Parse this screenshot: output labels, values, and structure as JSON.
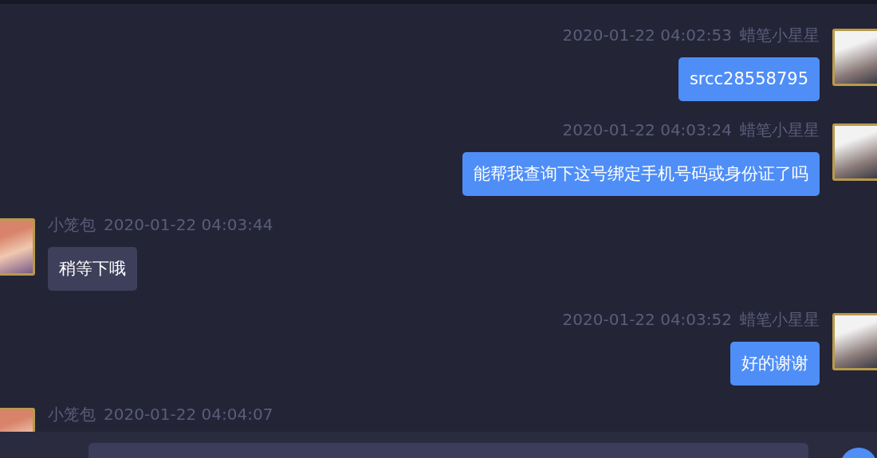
{
  "messages": [
    {
      "kind": "right",
      "time": "2020-01-22 04:02:53",
      "sender": "蜡笔小星星",
      "text": "srcc28558795"
    },
    {
      "kind": "right",
      "time": "2020-01-22 04:03:24",
      "sender": "蜡笔小星星",
      "text": "能帮我查询下这号绑定手机号码或身份证了吗"
    },
    {
      "kind": "left",
      "time": "2020-01-22 04:03:44",
      "sender": "小笼包",
      "text": "稍等下哦"
    },
    {
      "kind": "right",
      "time": "2020-01-22 04:03:52",
      "sender": "蜡笔小星星",
      "text": "好的谢谢"
    },
    {
      "kind": "left",
      "time": "2020-01-22 04:04:07",
      "sender": "小笼包"
    }
  ]
}
